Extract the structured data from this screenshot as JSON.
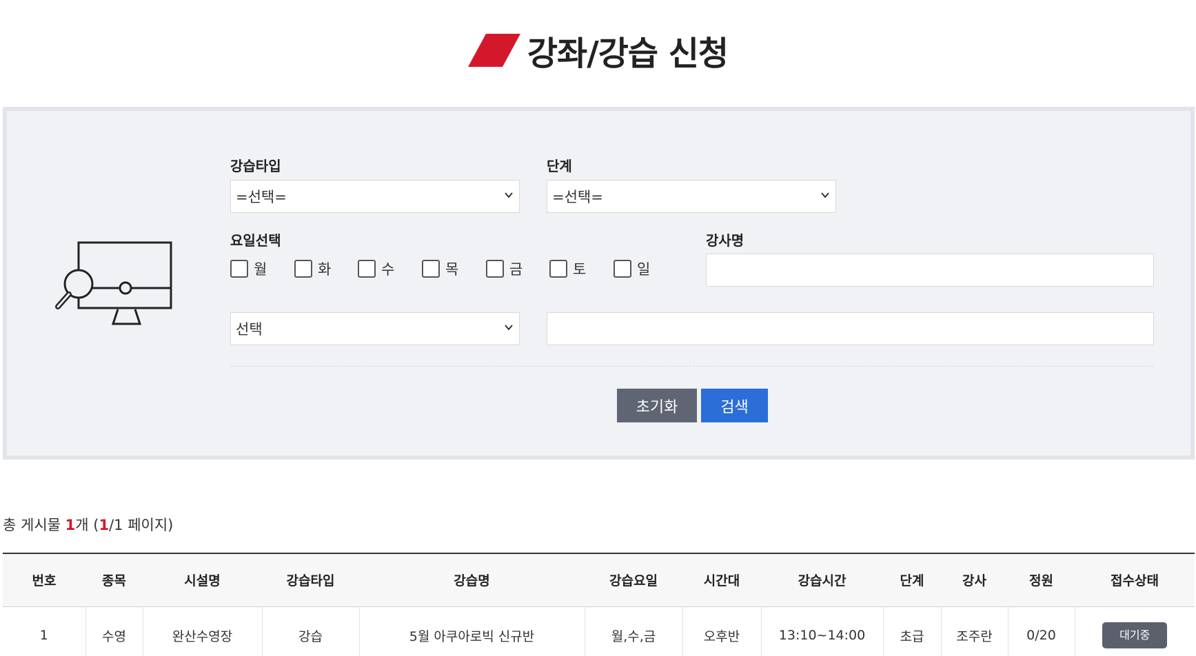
{
  "header": {
    "title": "강좌/강습 신청"
  },
  "search": {
    "lesson_type_label": "강습타입",
    "lesson_type_value": "=선택=",
    "level_label": "단계",
    "level_value": "=선택=",
    "day_label": "요일선택",
    "days": [
      "월",
      "화",
      "수",
      "목",
      "금",
      "토",
      "일"
    ],
    "instructor_label": "강사명",
    "instructor_value": "",
    "keyword_select_value": "선택",
    "keyword_value": "",
    "reset_label": "초기화",
    "search_label": "검색"
  },
  "summary": {
    "prefix": "총 게시물 ",
    "count": "1",
    "unit": "개 (",
    "page": "1",
    "page_total": "/1 페이지)"
  },
  "table": {
    "headers": [
      "번호",
      "종목",
      "시설명",
      "강습타입",
      "강습명",
      "강습요일",
      "시간대",
      "강습시간",
      "단계",
      "강사",
      "정원",
      "접수상태"
    ],
    "rows": [
      [
        "1",
        "수영",
        "완산수영장",
        "강습",
        "5월 아쿠아로빅 신규반",
        "월,수,금",
        "오후반",
        "13:10~14:00",
        "초급",
        "조주란",
        "0/20",
        "대기중"
      ]
    ]
  },
  "colors": {
    "accent": "#d4182c",
    "primary_button": "#2b6ed8",
    "reset_button": "#5f6572"
  }
}
